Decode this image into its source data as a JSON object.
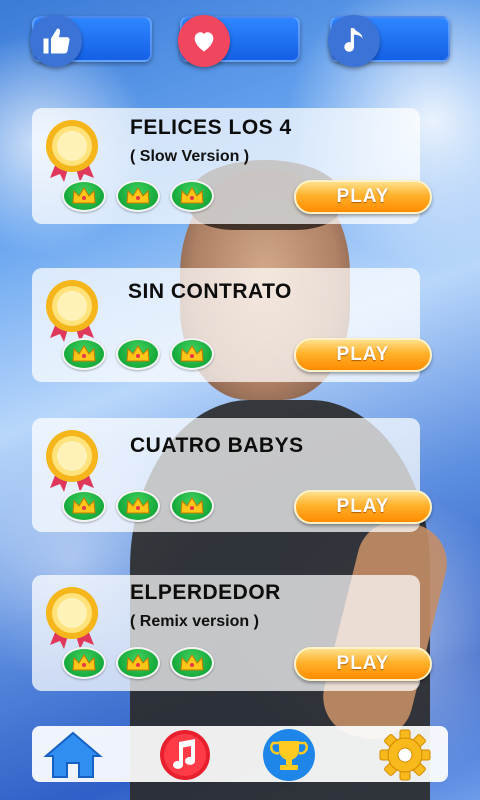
{
  "top_bar": {
    "like_icon": "thumbs-up-icon",
    "favorite_icon": "heart-icon",
    "music_icon": "music-note-icon"
  },
  "songs": [
    {
      "title": "FELICES LOS 4",
      "subtitle": "( Slow Version )",
      "crowns": 3,
      "play_label": "PLAY"
    },
    {
      "title": "SIN CONTRATO",
      "subtitle": "",
      "crowns": 3,
      "play_label": "PLAY"
    },
    {
      "title": "CUATRO BABYS",
      "subtitle": "",
      "crowns": 3,
      "play_label": "PLAY"
    },
    {
      "title": "ELPERDEDOR",
      "subtitle": "( Remix version )",
      "crowns": 3,
      "play_label": "PLAY"
    }
  ],
  "bottom_nav": {
    "home_icon": "home-icon",
    "music_app_icon": "music-app-icon",
    "trophy_icon": "trophy-icon",
    "settings_icon": "gear-icon"
  },
  "colors": {
    "blue_button": "#1460e6",
    "heart_red": "#f0475f",
    "crown_green": "#14a83a",
    "play_orange": "#ff8b00"
  }
}
